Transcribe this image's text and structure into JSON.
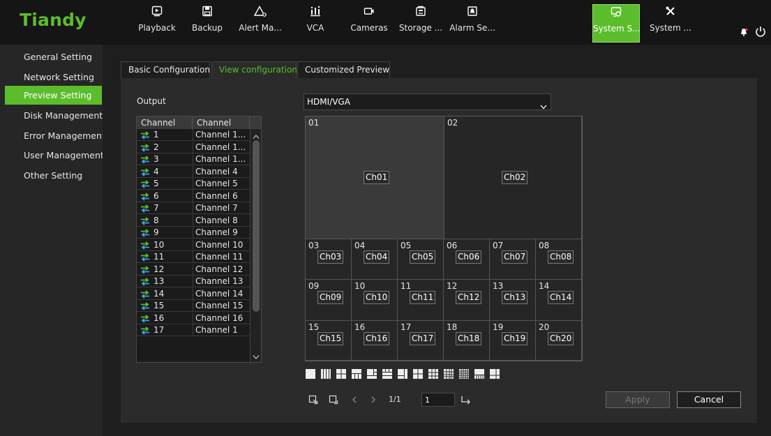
{
  "app": {
    "logo": "Tiandy"
  },
  "nav": [
    {
      "label": "Playback",
      "icon": "playback-icon"
    },
    {
      "label": "Backup",
      "icon": "save-icon"
    },
    {
      "label": "Alert Ma...",
      "icon": "alert-icon"
    },
    {
      "label": "VCA",
      "icon": "vca-icon"
    },
    {
      "label": "Cameras",
      "icon": "camera-icon"
    },
    {
      "label": "Storage ...",
      "icon": "storage-icon"
    },
    {
      "label": "Alarm Se...",
      "icon": "alarm-icon"
    },
    {
      "label": "System S...",
      "icon": "system-settings-icon",
      "active": true
    },
    {
      "label": "System ...",
      "icon": "tools-icon"
    }
  ],
  "sidebar": {
    "items": [
      {
        "label": "General Setting"
      },
      {
        "label": "Network Setting"
      },
      {
        "label": "Preview Setting",
        "active": true
      },
      {
        "label": "Disk Management"
      },
      {
        "label": "Error Management"
      },
      {
        "label": "User Management"
      },
      {
        "label": "Other Setting"
      }
    ]
  },
  "tabs": [
    {
      "label": "Basic Configuration"
    },
    {
      "label": "View configuration",
      "active": true
    },
    {
      "label": "Customized Preview"
    }
  ],
  "output": {
    "label": "Output",
    "value": "HDMI/VGA"
  },
  "channel_list": {
    "headers": [
      "Channel",
      "Channel"
    ],
    "rows": [
      {
        "num": "1",
        "name": "Channel 1..."
      },
      {
        "num": "2",
        "name": "Channel 1..."
      },
      {
        "num": "3",
        "name": "Channel 1..."
      },
      {
        "num": "4",
        "name": "Channel 4"
      },
      {
        "num": "5",
        "name": "Channel 5"
      },
      {
        "num": "6",
        "name": "Channel 6"
      },
      {
        "num": "7",
        "name": "Channel 7"
      },
      {
        "num": "8",
        "name": "Channel 8"
      },
      {
        "num": "9",
        "name": "Channel 9"
      },
      {
        "num": "10",
        "name": "Channel 10"
      },
      {
        "num": "11",
        "name": "Channel 11"
      },
      {
        "num": "12",
        "name": "Channel 12"
      },
      {
        "num": "13",
        "name": "Channel 13"
      },
      {
        "num": "14",
        "name": "Channel 14"
      },
      {
        "num": "15",
        "name": "Channel 15"
      },
      {
        "num": "16",
        "name": "Channel 16"
      },
      {
        "num": "17",
        "name": "Channel 1"
      }
    ]
  },
  "grid": {
    "cells": [
      {
        "num": "01",
        "tag": "Ch01"
      },
      {
        "num": "02",
        "tag": "Ch02"
      },
      {
        "num": "03",
        "tag": "Ch03"
      },
      {
        "num": "04",
        "tag": "Ch04"
      },
      {
        "num": "05",
        "tag": "Ch05"
      },
      {
        "num": "06",
        "tag": "Ch06"
      },
      {
        "num": "07",
        "tag": "Ch07"
      },
      {
        "num": "08",
        "tag": "Ch08"
      },
      {
        "num": "09",
        "tag": "Ch09"
      },
      {
        "num": "10",
        "tag": "Ch10"
      },
      {
        "num": "11",
        "tag": "Ch11"
      },
      {
        "num": "12",
        "tag": "Ch12"
      },
      {
        "num": "13",
        "tag": "Ch13"
      },
      {
        "num": "14",
        "tag": "Ch14"
      },
      {
        "num": "15",
        "tag": "Ch15"
      },
      {
        "num": "16",
        "tag": "Ch16"
      },
      {
        "num": "17",
        "tag": "Ch17"
      },
      {
        "num": "18",
        "tag": "Ch18"
      },
      {
        "num": "19",
        "tag": "Ch19"
      },
      {
        "num": "20",
        "tag": "Ch20"
      }
    ]
  },
  "layouts": [
    "layout-1-icon",
    "layout-4-icon",
    "layout-6-icon",
    "layout-8-icon",
    "layout-9-icon",
    "layout-10-icon",
    "layout-13-icon",
    "layout-16-icon",
    "layout-20-icon",
    "layout-25-icon",
    "layout-32-icon",
    "layout-36-icon",
    "layout-64-icon"
  ],
  "pager": {
    "page_info": "1/1",
    "page_value": "1"
  },
  "buttons": {
    "apply": "Apply",
    "cancel": "Cancel"
  },
  "colors": {
    "accent": "#5bbd2b",
    "background": "#1e1e1e",
    "panel": "#2b2b2b"
  }
}
